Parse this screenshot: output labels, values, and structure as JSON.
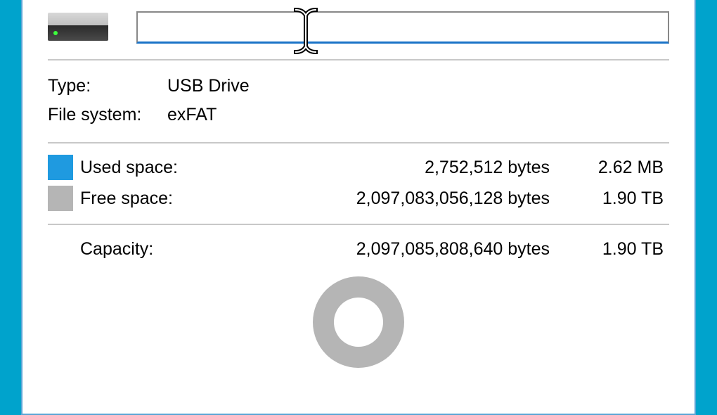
{
  "drive": {
    "name_value": "",
    "name_placeholder": ""
  },
  "info": {
    "type_label": "Type:",
    "type_value": "USB Drive",
    "fs_label": "File system:",
    "fs_value": "exFAT"
  },
  "colors": {
    "used": "#1f9ae0",
    "free": "#b5b5b5"
  },
  "space": {
    "used_label": "Used space:",
    "used_bytes": "2,752,512 bytes",
    "used_hr": "2.62 MB",
    "free_label": "Free space:",
    "free_bytes": "2,097,083,056,128 bytes",
    "free_hr": "1.90 TB"
  },
  "capacity": {
    "label": "Capacity:",
    "bytes": "2,097,085,808,640 bytes",
    "hr": "1.90 TB"
  }
}
